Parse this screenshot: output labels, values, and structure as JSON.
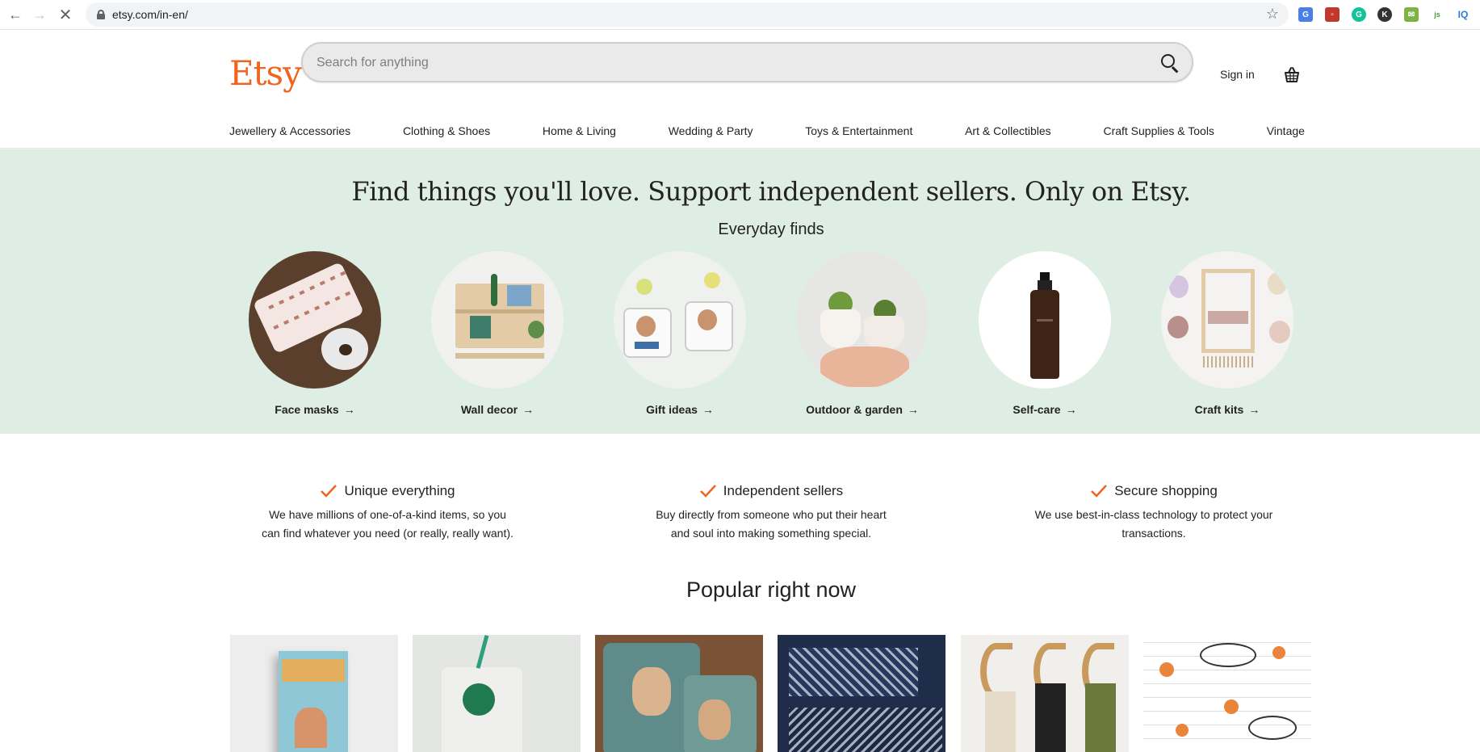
{
  "browser": {
    "url": "etsy.com/in-en/"
  },
  "header": {
    "logo": "Etsy",
    "search_placeholder": "Search for anything",
    "sign_in": "Sign in"
  },
  "categories": [
    "Jewellery & Accessories",
    "Clothing & Shoes",
    "Home & Living",
    "Wedding & Party",
    "Toys & Entertainment",
    "Art & Collectibles",
    "Craft Supplies & Tools",
    "Vintage"
  ],
  "hero": {
    "title": "Find things you'll love. Support independent sellers. Only on Etsy.",
    "subtitle": "Everyday finds",
    "items": [
      {
        "label": "Face masks"
      },
      {
        "label": "Wall decor"
      },
      {
        "label": "Gift ideas"
      },
      {
        "label": "Outdoor & garden"
      },
      {
        "label": "Self-care"
      },
      {
        "label": "Craft kits"
      }
    ]
  },
  "value_props": [
    {
      "title": "Unique everything",
      "line1": "We have millions of one-of-a-kind items, so you",
      "line2": "can find whatever you need (or really, really want)."
    },
    {
      "title": "Independent sellers",
      "line1": "Buy directly from someone who put their heart",
      "line2": "and soul into making something special."
    },
    {
      "title": "Secure shopping",
      "line1": "We use best-in-class technology to protect your",
      "line2": "transactions."
    }
  ],
  "popular": {
    "title": "Popular right now"
  },
  "colors": {
    "brand": "#f1641e",
    "hero_bg": "#dfeee4"
  }
}
